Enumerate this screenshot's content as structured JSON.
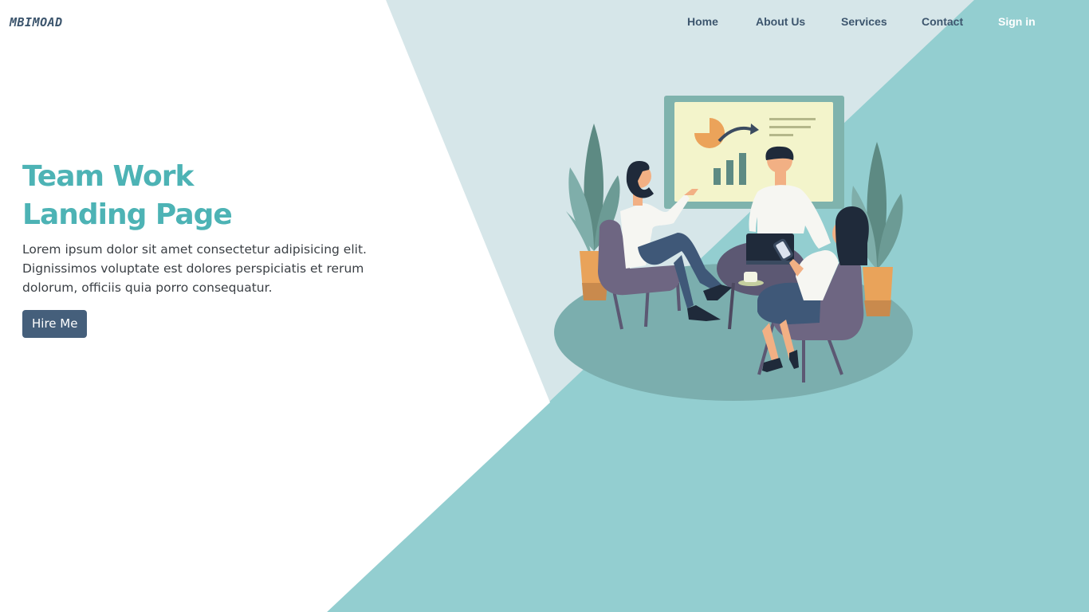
{
  "brand": {
    "logo_text": "MBIMOAD"
  },
  "nav": {
    "items": [
      {
        "label": "Home"
      },
      {
        "label": "About Us"
      },
      {
        "label": "Services"
      },
      {
        "label": "Contact"
      },
      {
        "label": "Sign in"
      }
    ]
  },
  "hero": {
    "title_line1": "Team Work",
    "title_line2": "Landing Page",
    "description": "Lorem ipsum dolor sit amet consectetur adipisicing elit. Dignissimos voluptate est dolores perspiciatis et rerum dolorum, officiis quia porro consequatur.",
    "cta_label": "Hire Me"
  },
  "colors": {
    "accent": "#4db3b5",
    "light_panel": "#d6e6e9",
    "teal_panel": "#93ced0",
    "nav_text": "#3d566e",
    "button": "#455f7b"
  }
}
